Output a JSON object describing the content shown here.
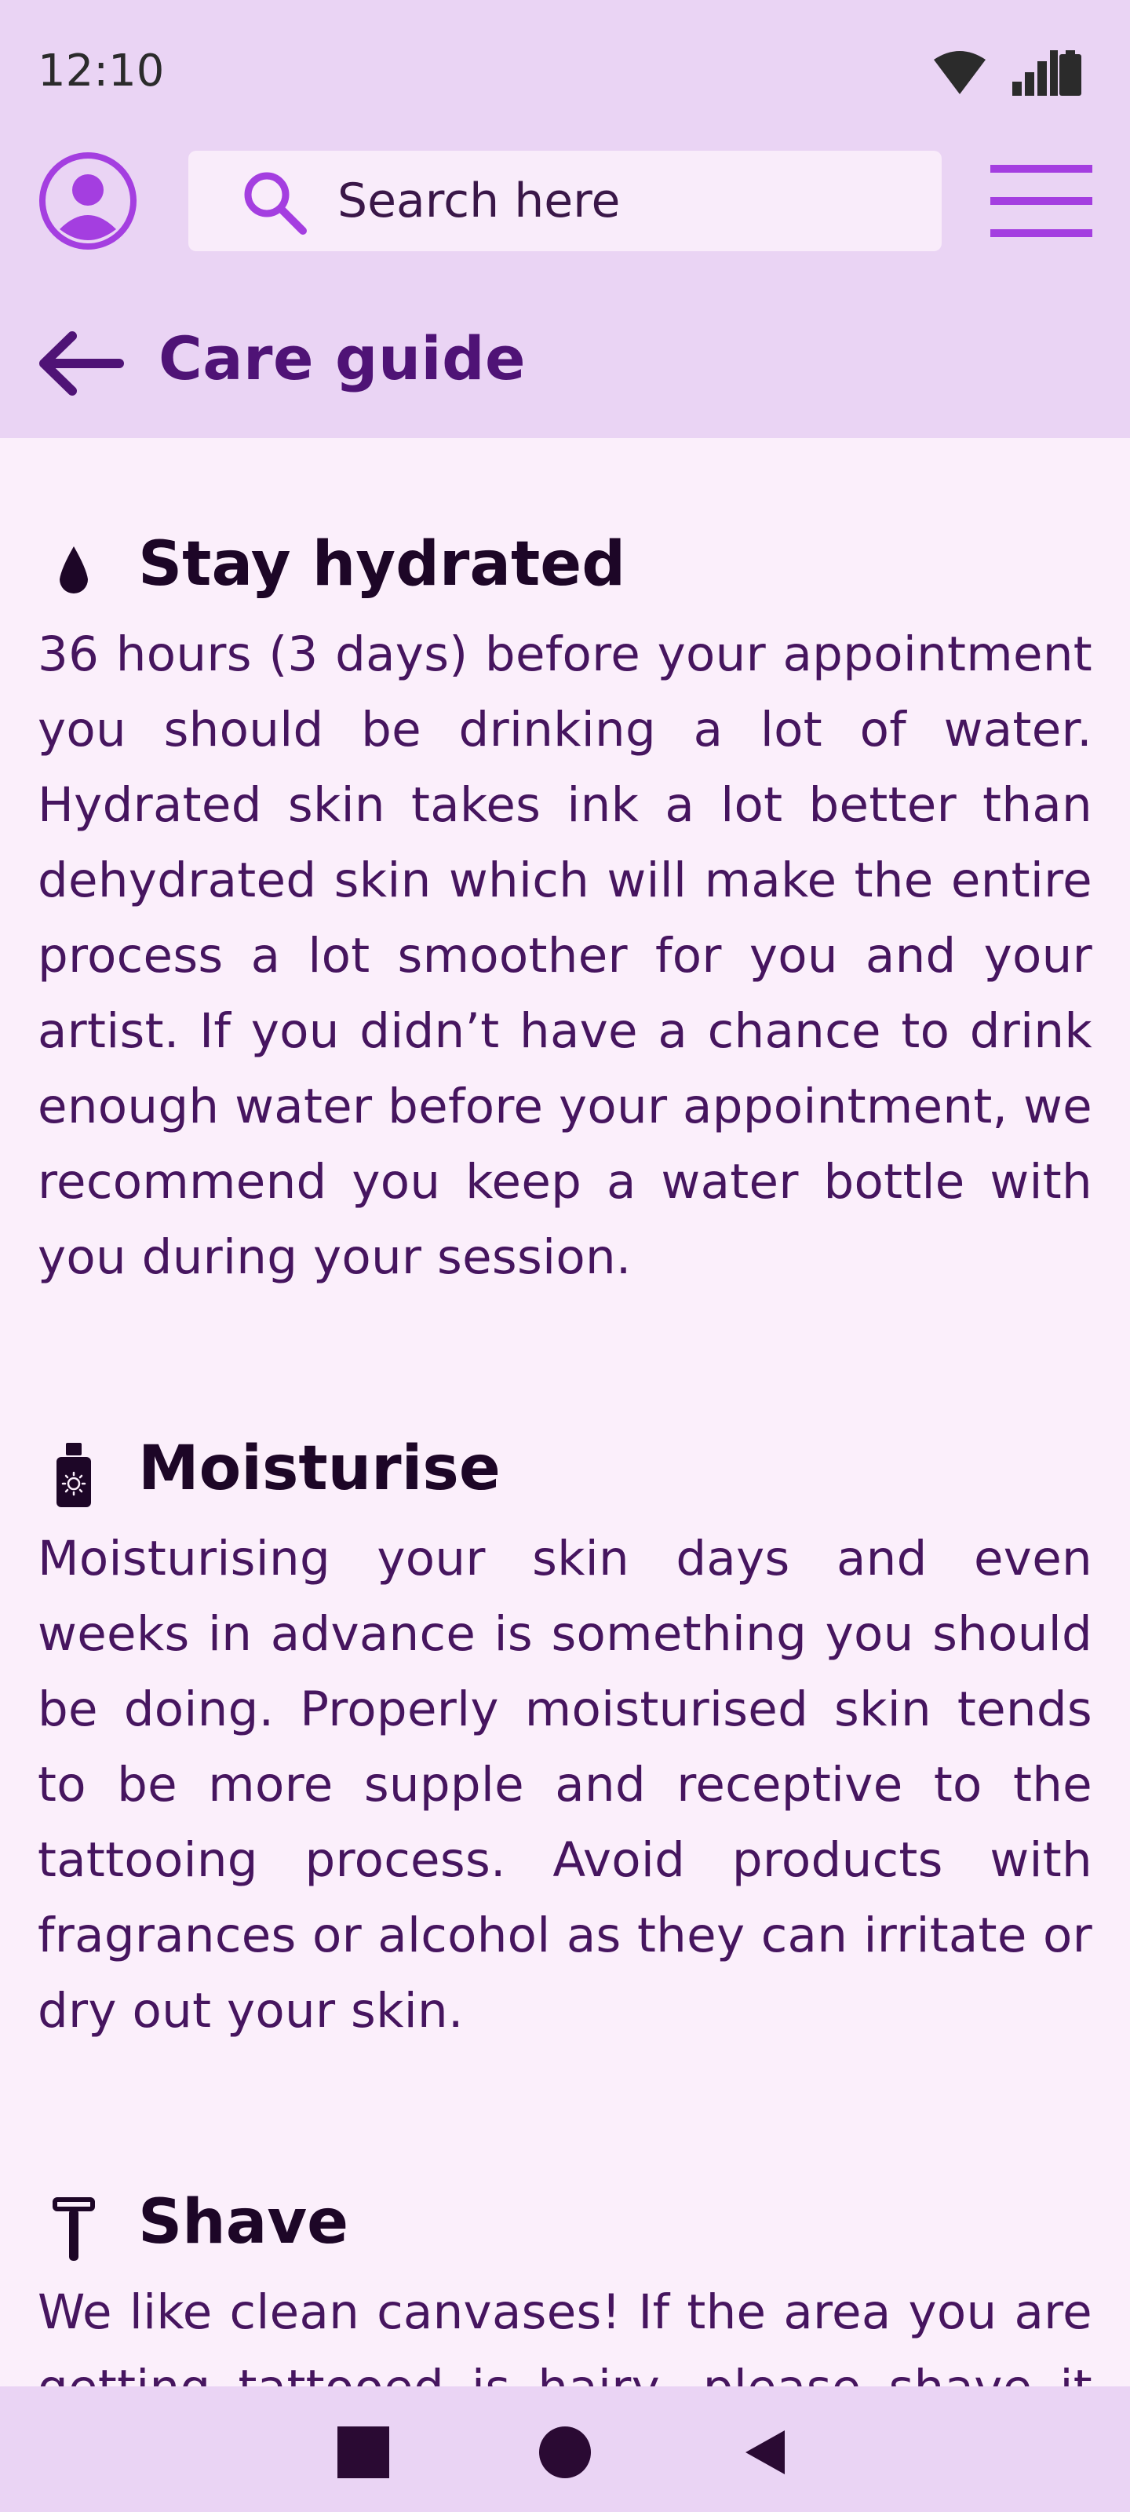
{
  "status_bar": {
    "time": "12:10",
    "icons": [
      "wifi-icon",
      "signal-icon",
      "battery-icon"
    ]
  },
  "header": {
    "profile_icon": "account-circle-icon",
    "search": {
      "placeholder": "Search here",
      "value": ""
    },
    "menu_icon": "hamburger-menu-icon"
  },
  "page": {
    "back_icon": "arrow-left-icon",
    "title": "Care guide"
  },
  "sections": [
    {
      "icon": "water-drop-icon",
      "title": "Stay hydrated",
      "body": "36 hours (3 days) before your appointment you should be drinking a lot of water. Hydrated skin takes ink a lot better than dehydrated skin which will make the entire process a lot smoother for you and your artist. If you didn’t have a chance to drink enough water before your appointment, we recommend you keep a water bottle with you during your session."
    },
    {
      "icon": "sunscreen-bottle-icon",
      "title": "Moisturise",
      "body": "Moisturising your skin days and even weeks in advance is something you should be doing. Properly moisturised skin tends to be more supple and receptive to the tattooing process. Avoid products with fragrances or alcohol as they can irritate or dry out your skin."
    },
    {
      "icon": "razor-icon",
      "title": "Shave",
      "body": "We like clean canvases! If the area you are getting tattooed is hairy, please shave it beforehand."
    }
  ],
  "nav_bar": {
    "buttons": [
      "recents-square-icon",
      "home-circle-icon",
      "back-triangle-icon"
    ]
  },
  "colors": {
    "header_bg": "#ead4f4",
    "content_bg": "#fbeffb",
    "accent": "#a43ee0",
    "title": "#4f1376",
    "body_text": "#46155f"
  }
}
